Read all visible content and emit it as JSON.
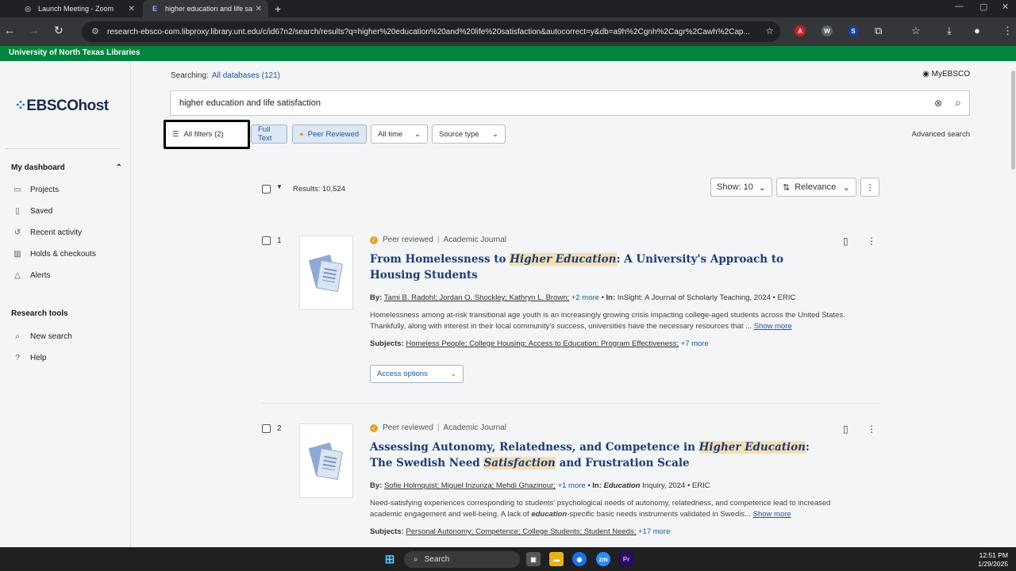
{
  "browser": {
    "tabs": [
      {
        "title": "Launch Meeting - Zoom",
        "active": false
      },
      {
        "title": "higher education and life sa",
        "active": true
      }
    ],
    "url": "research-ebsco-com.libproxy.library.unt.edu/c/id67n2/search/results?q=higher%20education%20and%20life%20satisfaction&autocorrect=y&db=a9h%2Cgnh%2Cagr%2Cawh%2Cap..."
  },
  "library_bar": "University of North Texas Libraries",
  "sidebar": {
    "logo": "EBSCOhost",
    "dashboard_heading": "My dashboard",
    "dashboard_items": [
      {
        "label": "Projects",
        "icon": "folder-icon"
      },
      {
        "label": "Saved",
        "icon": "bookmark-icon"
      },
      {
        "label": "Recent activity",
        "icon": "history-icon"
      },
      {
        "label": "Holds & checkouts",
        "icon": "books-icon"
      },
      {
        "label": "Alerts",
        "icon": "bell-icon"
      }
    ],
    "tools_heading": "Research tools",
    "tools_items": [
      {
        "label": "New search",
        "icon": "search-icon"
      },
      {
        "label": "Help",
        "icon": "help-icon"
      }
    ]
  },
  "search": {
    "searching_label": "Searching:",
    "databases_link": "All databases (121)",
    "myebsco": "MyEBSCO",
    "query": "higher education and life satisfaction",
    "advanced": "Advanced search"
  },
  "filters": {
    "all_filters": "All filters (2)",
    "full_text": "Full Text",
    "peer_reviewed": "Peer Reviewed",
    "all_time": "All time",
    "source_type": "Source type"
  },
  "results_bar": {
    "count": "Results: 10,524",
    "show": "Show: 10",
    "sort": "Relevance"
  },
  "results": [
    {
      "num": "1",
      "peer": "Peer reviewed",
      "type": "Academic Journal",
      "title_pre": "From Homelessness to ",
      "title_hl": "Higher Education",
      "title_post": ": A University's Approach to Housing Students",
      "by_label": "By:",
      "authors": "Tami B. Radohl; Jordan O. Shockley; Kathryn L. Brown;",
      "more_authors": "+2 more",
      "in_label": "In:",
      "source": "InSight: A Journal of Scholarly Teaching, 2024 • ERIC",
      "abstract": "Homelessness among at-risk transitional age youth is an increasingly growing crisis impacting college-aged students across the United States. Thankfully, along with interest in their local community's success, universities have the necessary resources that ...",
      "show_more": "Show more",
      "subjects_label": "Subjects:",
      "subjects": "Homeless People; College Housing; Access to Education; Program Effectiveness;",
      "more_subjects": "+7 more",
      "access": "Access options"
    },
    {
      "num": "2",
      "peer": "Peer reviewed",
      "type": "Academic Journal",
      "title_a": "Assessing Autonomy, Relatedness, and Competence in ",
      "title_hl1": "Higher Education",
      "title_b": ": The Swedish Need ",
      "title_hl2": "Satisfaction",
      "title_c": " and Frustration Scale",
      "by_label": "By:",
      "authors": "Sofie Holmquist; Miguel Inzunza; Mehdi Ghazinour;",
      "more_authors": "+1 more",
      "in_label": "In:",
      "source_em": "Education",
      "source": " Inquiry, 2024 • ERIC",
      "abstract_a": "Need-satisfying experiences corresponding to students' psychological needs of autonomy, relatedness, and competence lead to increased academic engagement and well-being. A lack of ",
      "abstract_em": "education",
      "abstract_b": "-specific basic needs instruments validated in Swedis...",
      "show_more": "Show more",
      "subjects_label": "Subjects:",
      "subjects": "Personal Autonomy; Competence; College Students; Student Needs;",
      "more_subjects": "+17 more"
    }
  ],
  "taskbar": {
    "search": "Search",
    "time": "12:51 PM",
    "date": "1/29/2025"
  }
}
